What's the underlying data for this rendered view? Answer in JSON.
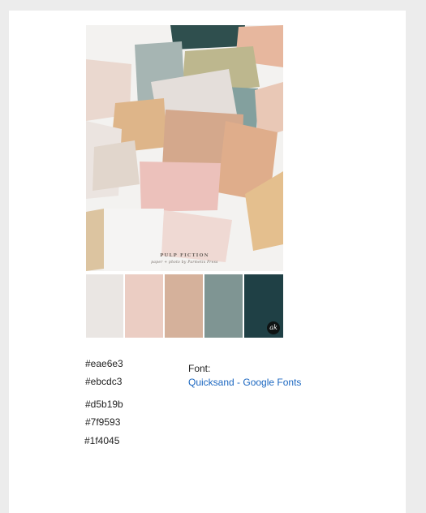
{
  "palette": {
    "swatches": [
      {
        "hex": "#eae6e3",
        "label": "#eae6e3"
      },
      {
        "hex": "#ebcdc3",
        "label": "#ebcdc3"
      },
      {
        "hex": "#d5b19b",
        "label": "#d5b19b"
      },
      {
        "hex": "#7f9593",
        "label": "#7f9593"
      },
      {
        "hex": "#1f4045",
        "label": "#1f4045"
      }
    ],
    "badge_text": "ak"
  },
  "photo": {
    "title": "PULP FICTION",
    "subtitle": "paper + photo by Parmetis Press"
  },
  "font_info": {
    "label": "Font:",
    "link_text": "Quicksand - Google Fonts"
  }
}
